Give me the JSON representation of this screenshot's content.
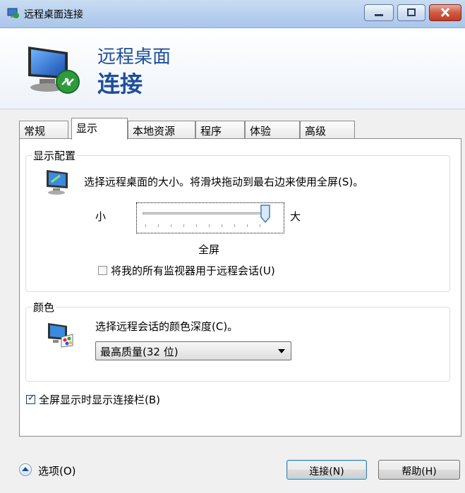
{
  "window": {
    "title": "远程桌面连接"
  },
  "banner": {
    "line1": "远程桌面",
    "line2": "连接"
  },
  "tabs": [
    {
      "label": "常规"
    },
    {
      "label": "显示"
    },
    {
      "label": "本地资源"
    },
    {
      "label": "程序"
    },
    {
      "label": "体验"
    },
    {
      "label": "高级"
    }
  ],
  "display_config": {
    "title": "显示配置",
    "description": "选择远程桌面的大小。将滑块拖动到最右边来使用全屏(S)。",
    "small_label": "小",
    "large_label": "大",
    "size_value_label": "全屏",
    "slider_level": 1.0,
    "monitors_checkbox_label": "将我的所有监视器用于远程会话(U)",
    "monitors_checked": false
  },
  "colors": {
    "title": "颜色",
    "description": "选择远程会话的颜色深度(C)。",
    "selected": "最高质量(32 位)"
  },
  "connection_bar": {
    "label": "全屏显示时显示连接栏(B)",
    "checked": true
  },
  "footer": {
    "options_label": "选项(O)",
    "connect_label": "连接(N)",
    "help_label": "帮助(H)"
  }
}
